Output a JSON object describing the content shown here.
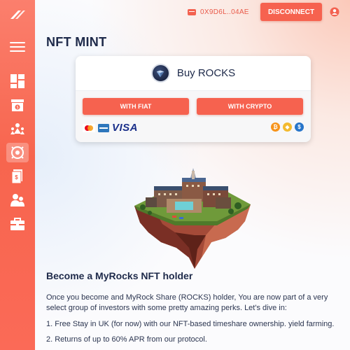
{
  "wallet": {
    "address": "0X9D6L..04AE"
  },
  "header": {
    "disconnect_label": "DISCONNECT"
  },
  "page": {
    "title": "NFT MINT"
  },
  "buy_card": {
    "title": "Buy ROCKS",
    "fiat_label": "WITH FIAT",
    "crypto_label": "WITH CRYPTO",
    "fiat_brand_text": "VISA",
    "crypto_coins": [
      {
        "icon": "bitcoin-icon",
        "color": "#f7931a",
        "glyph": "₿"
      },
      {
        "icon": "bnb-icon",
        "color": "#f3ba2f",
        "glyph": "◆"
      },
      {
        "icon": "usdc-icon",
        "color": "#2775ca",
        "glyph": "$"
      }
    ]
  },
  "sidebar": {
    "items": [
      {
        "icon": "dashboard-icon"
      },
      {
        "icon": "nft-store-icon"
      },
      {
        "icon": "community-icon"
      },
      {
        "icon": "nft-mint-icon",
        "active": true
      },
      {
        "icon": "document-icon"
      },
      {
        "icon": "team-icon"
      },
      {
        "icon": "briefcase-icon"
      }
    ]
  },
  "content": {
    "heading": "Become a MyRocks NFT holder",
    "paragraphs": [
      "Once you become and MyRock Share (ROCKS) holder, You are now part of a very select group of investors with some pretty amazing perks. Let's dive in:",
      "1. Free Stay in UK (for now) with our NFT-based timeshare ownership. yield farming.",
      "2. Returns of up to 60% APR from our protocol."
    ]
  },
  "colors": {
    "accent": "#f6624f",
    "sidebar": "#f7654e",
    "text_dark": "#1e2a4a"
  }
}
